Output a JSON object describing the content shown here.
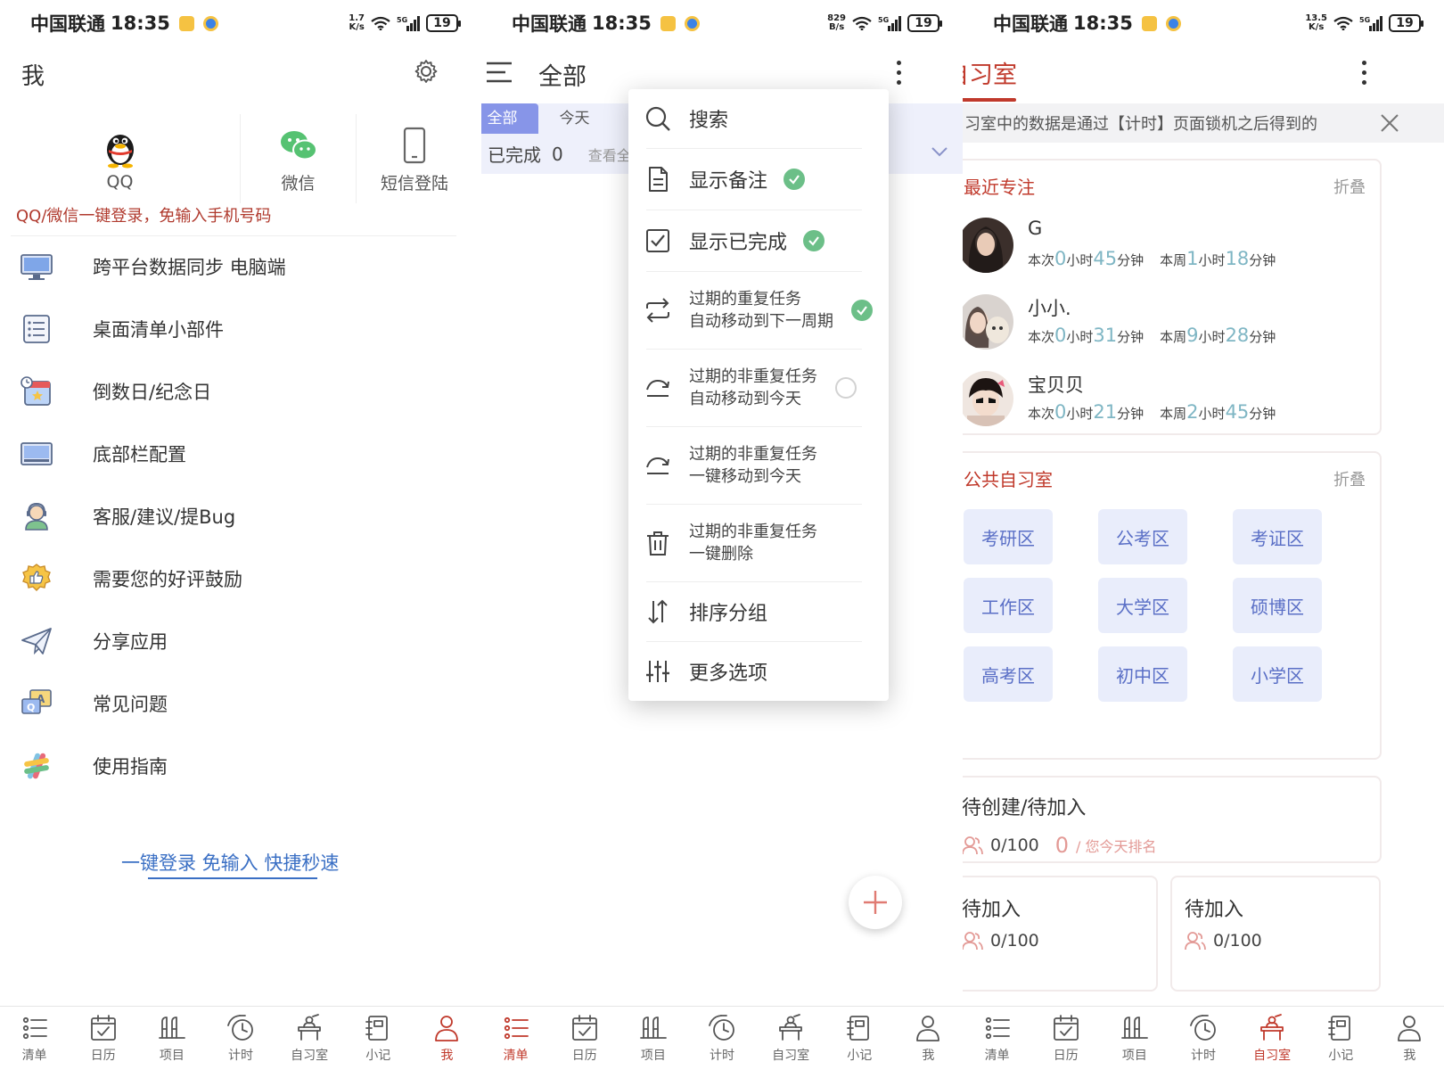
{
  "status_bar": {
    "carrier": "中国联通",
    "time": "18:35",
    "battery": "19",
    "network": "5G",
    "speeds": [
      {
        "value": "1.7",
        "unit": "K/s"
      },
      {
        "value": "829",
        "unit": "B/s"
      },
      {
        "value": "13.5",
        "unit": "K/s"
      }
    ]
  },
  "bottom_nav": {
    "items": [
      {
        "label": "清单",
        "icon": "list-icon"
      },
      {
        "label": "日历",
        "icon": "calendar-icon"
      },
      {
        "label": "项目",
        "icon": "project-icon"
      },
      {
        "label": "计时",
        "icon": "timer-icon"
      },
      {
        "label": "自习室",
        "icon": "study-room-icon"
      },
      {
        "label": "小记",
        "icon": "notebook-icon"
      },
      {
        "label": "我",
        "icon": "person-icon"
      }
    ],
    "active_per_screen": [
      "我",
      "清单",
      "自习室"
    ],
    "active_color": "#c0392b"
  },
  "me_screen": {
    "title": "我",
    "login_options": [
      {
        "label": "QQ",
        "icon": "qq-penguin-icon"
      },
      {
        "label": "微信",
        "icon": "wechat-icon"
      },
      {
        "label": "短信登陆",
        "icon": "phone-icon"
      }
    ],
    "login_tip": "QQ/微信一键登录，免输入手机号码",
    "menu_items": [
      {
        "label": "跨平台数据同步 电脑端",
        "icon": "monitor-icon"
      },
      {
        "label": "桌面清单小部件",
        "icon": "checklist-widget-icon"
      },
      {
        "label": "倒数日/纪念日",
        "icon": "countdown-calendar-icon"
      },
      {
        "label": "底部栏配置",
        "icon": "bottom-bar-config-icon"
      },
      {
        "label": "客服/建议/提Bug",
        "icon": "customer-service-icon"
      },
      {
        "label": "需要您的好评鼓励",
        "icon": "thumbs-up-badge-icon"
      },
      {
        "label": "分享应用",
        "icon": "paper-plane-icon"
      },
      {
        "label": "常见问题",
        "icon": "faq-icon"
      },
      {
        "label": "使用指南",
        "icon": "guide-icon"
      }
    ],
    "quick_login_link": "一键登录 免输入 快捷秒速"
  },
  "list_screen": {
    "title": "全部",
    "tabs": [
      {
        "label": "全部",
        "active": true
      },
      {
        "label": "今天",
        "active": false
      }
    ],
    "completed_label": "已完成",
    "completed_count": "0",
    "view_all": "查看全",
    "dropdown": [
      {
        "label": "搜索",
        "icon": "search-icon",
        "state": "none"
      },
      {
        "label": "显示备注",
        "icon": "note-icon",
        "state": "checked"
      },
      {
        "label": "显示已完成",
        "icon": "checkbox-icon",
        "state": "checked"
      },
      {
        "line1": "过期的重复任务",
        "line2": "自动移动到下一周期",
        "icon": "repeat-icon",
        "state": "checked"
      },
      {
        "line1": "过期的非重复任务",
        "line2": "自动移动到今天",
        "icon": "move-today-icon",
        "state": "unchecked"
      },
      {
        "line1": "过期的非重复任务",
        "line2": "一键移动到今天",
        "icon": "move-today-icon",
        "state": "none"
      },
      {
        "line1": "过期的非重复任务",
        "line2": "一键删除",
        "icon": "trash-icon",
        "state": "none"
      },
      {
        "label": "排序分组",
        "icon": "sort-icon",
        "state": "none"
      },
      {
        "label": "更多选项",
        "icon": "sliders-icon",
        "state": "none"
      }
    ],
    "check_color": "#6cbf88"
  },
  "study_screen": {
    "title": "自习室",
    "notice": "自习室中的数据是通过【计时】页面锁机之后得到的",
    "recent": {
      "title": "最近专注",
      "fold": "折叠",
      "labels": {
        "this_time": "本次",
        "this_week": "本周",
        "hour": "小时",
        "minute": "分钟"
      },
      "users": [
        {
          "name": "G",
          "this_h": "0",
          "this_m": "45",
          "week_h": "1",
          "week_m": "18"
        },
        {
          "name": "小小.",
          "this_h": "0",
          "this_m": "31",
          "week_h": "9",
          "week_m": "28"
        },
        {
          "name": "宝贝贝",
          "this_h": "0",
          "this_m": "21",
          "week_h": "2",
          "week_m": "45"
        }
      ]
    },
    "public": {
      "title": "公共自习室",
      "fold": "折叠",
      "zones": [
        "考研区",
        "公考区",
        "考证区",
        "工作区",
        "大学区",
        "硕博区",
        "高考区",
        "初中区",
        "小学区"
      ]
    },
    "rooms": [
      {
        "title": "待创建/待加入",
        "members": "0/100",
        "rank": "0",
        "rank_label": "/ 您今天排名"
      },
      {
        "title": "待加入",
        "members": "0/100"
      },
      {
        "title": "待加入",
        "members": "0/100"
      }
    ]
  }
}
